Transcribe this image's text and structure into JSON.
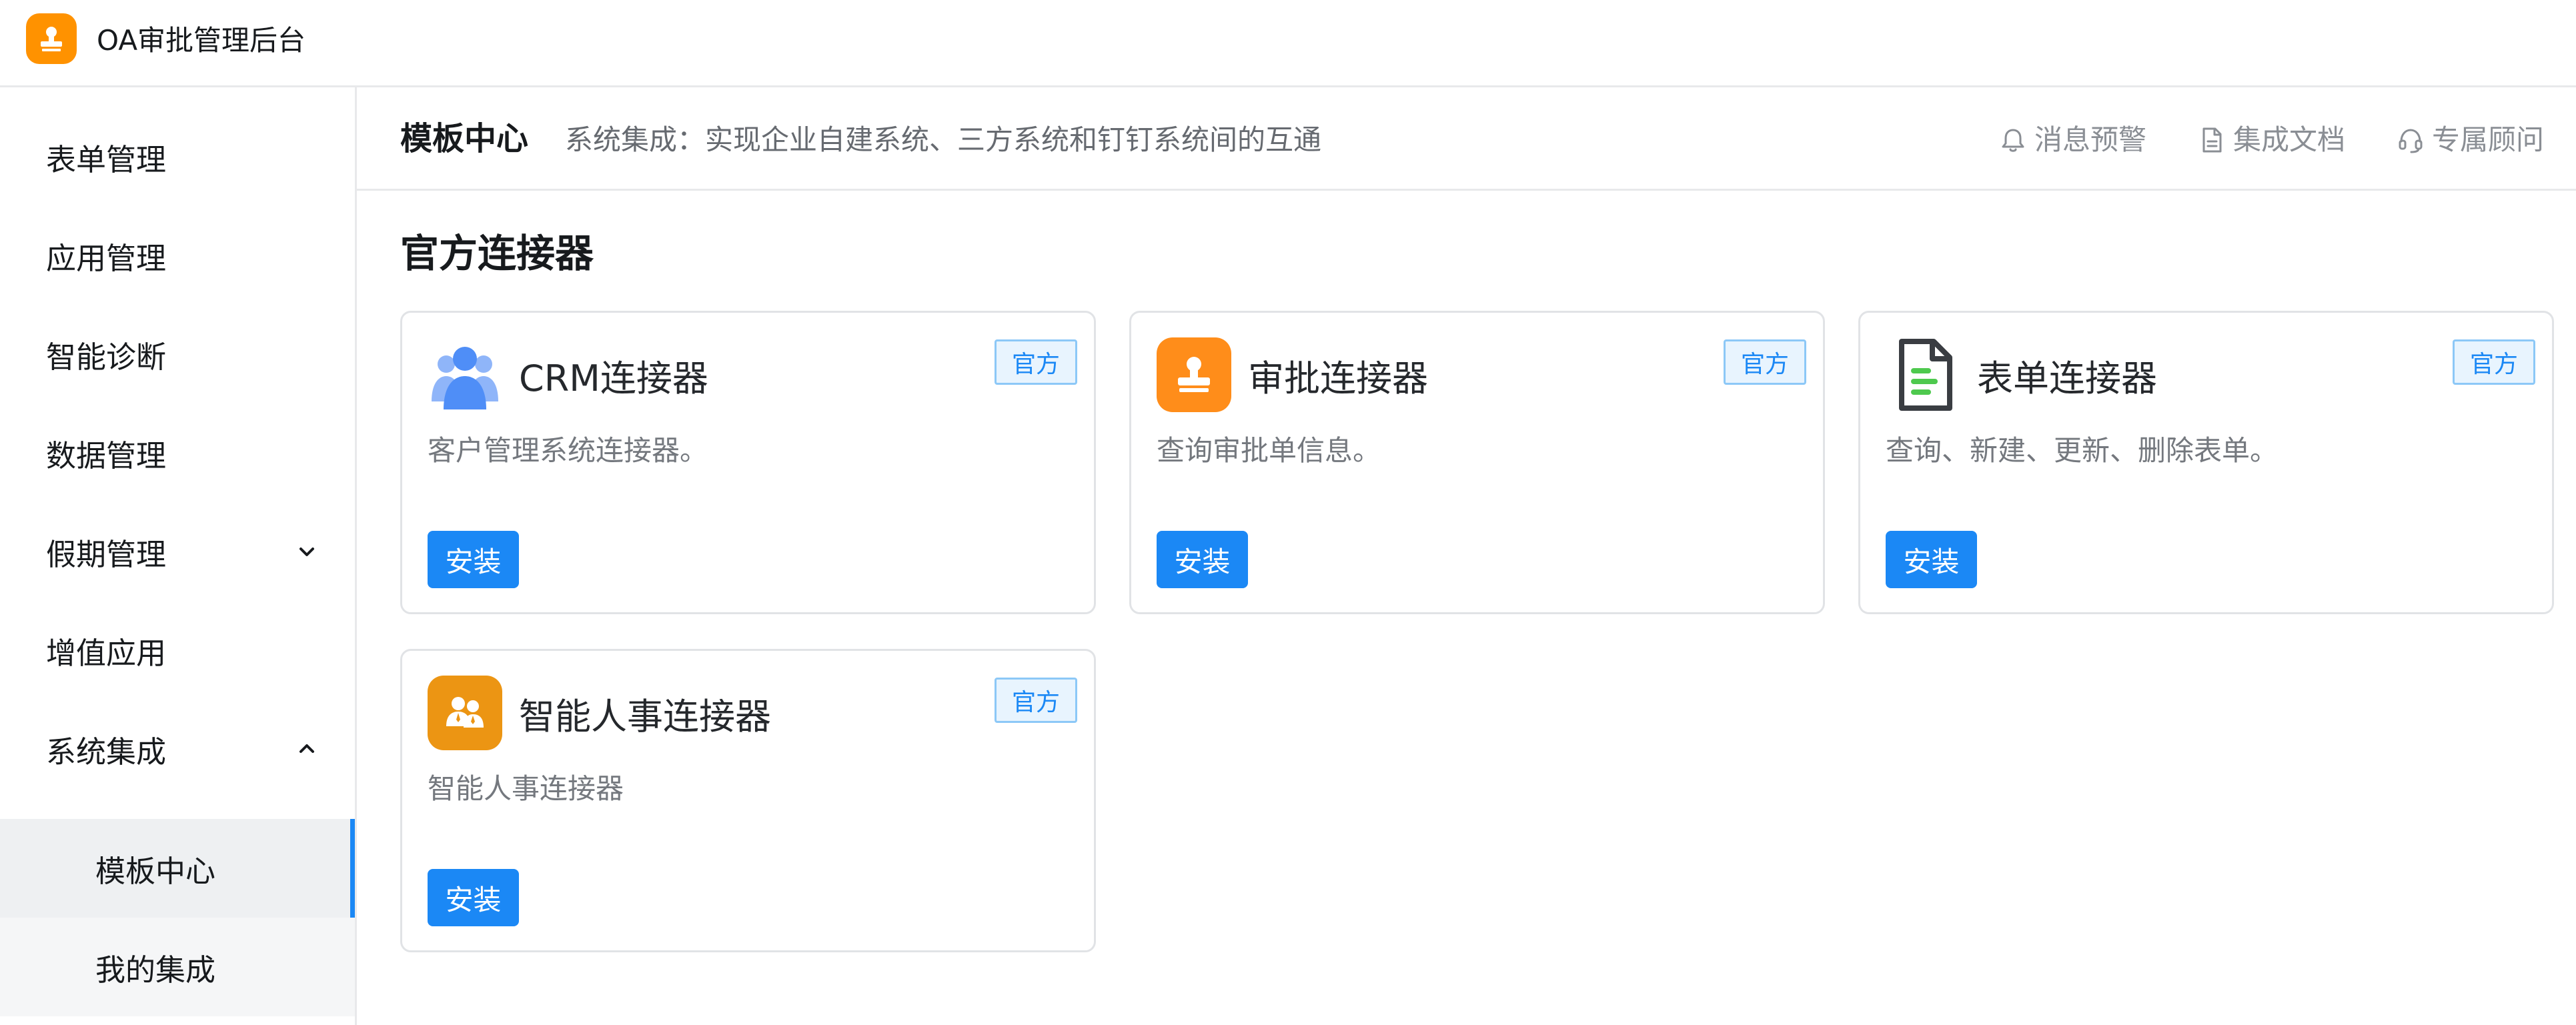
{
  "app": {
    "title": "OA审批管理后台"
  },
  "sidebar": {
    "items": [
      {
        "label": "表单管理"
      },
      {
        "label": "应用管理"
      },
      {
        "label": "智能诊断"
      },
      {
        "label": "数据管理"
      },
      {
        "label": "假期管理",
        "expanded": false
      },
      {
        "label": "增值应用"
      },
      {
        "label": "系统集成",
        "expanded": true
      }
    ],
    "subitems": [
      {
        "label": "模板中心",
        "active": true
      },
      {
        "label": "我的集成",
        "active": false
      }
    ]
  },
  "header": {
    "title": "模板中心",
    "description": "系统集成：实现企业自建系统、三方系统和钉钉系统间的互通",
    "actions": [
      {
        "label": "消息预警",
        "icon": "bell-icon"
      },
      {
        "label": "集成文档",
        "icon": "document-icon"
      },
      {
        "label": "专属顾问",
        "icon": "headset-icon"
      }
    ]
  },
  "section": {
    "title": "官方连接器"
  },
  "connectors": [
    {
      "name": "CRM连接器",
      "description": "客户管理系统连接器。",
      "badge": "官方",
      "button": "安装",
      "icon": "crm-users-icon",
      "color": "#4f8ef7"
    },
    {
      "name": "审批连接器",
      "description": "查询审批单信息。",
      "badge": "官方",
      "button": "安装",
      "icon": "approval-stamp-icon",
      "color": "#ff8d1a"
    },
    {
      "name": "表单连接器",
      "description": "查询、新建、更新、删除表单。",
      "badge": "官方",
      "button": "安装",
      "icon": "form-document-icon",
      "color": "#4ec94e"
    },
    {
      "name": "智能人事连接器",
      "description": "智能人事连接器",
      "badge": "官方",
      "button": "安装",
      "icon": "hr-people-icon",
      "color": "#ec9513"
    }
  ],
  "colors": {
    "accent": "#1b88f5",
    "brand": "#ff9200"
  }
}
